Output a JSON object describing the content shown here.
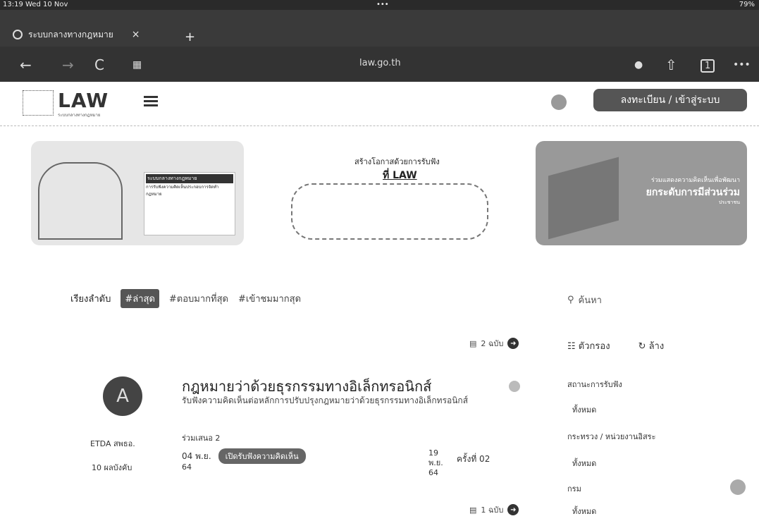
{
  "status": {
    "time": "13:19 Wed 10 Nov",
    "dots": "•••",
    "battery": "79%"
  },
  "browser": {
    "tab_title": "ระบบกลางทางกฎหมาย",
    "tab_close": "×",
    "new_tab": "+",
    "url": "law.go.th",
    "back": "←",
    "forward": "→",
    "reload": "C",
    "share": "⇧",
    "tabs_count": "1",
    "more": "•••"
  },
  "site": {
    "logo_word": "LAW",
    "logo_sub": "ระบบกลางทางกฎหมาย",
    "register_label": "ลงทะเบียน / เข้าสู่ระบบ"
  },
  "banners": [
    {
      "card_title": "ระบบกลางทางกฎหมาย",
      "card_text": "การรับฟังความคิดเห็นประกอบการจัดทำกฎหมาย"
    },
    {
      "line1": "สร้างโอกาสด้วยการรับฟัง",
      "line2": "ที่ LAW"
    },
    {
      "line1": "ร่วมแสดงความคิดเห็นเพื่อพัฒนา",
      "line2": "ยกระดับการมีส่วนร่วม",
      "line3": "ประชาชน"
    }
  ],
  "sort": {
    "label": "เรียงลำดับ",
    "options": [
      "#ล่าสุด",
      "#ตอบมากที่สุด",
      "#เข้าชมมากสุด"
    ]
  },
  "search": {
    "placeholder": "ค้นหา"
  },
  "filters": {
    "title": "ตัวกรอง",
    "clear": "ล้าง",
    "status_label": "สถานะการรับฟัง",
    "status_value": "ทั้งหมด",
    "ministry_label": "กระทรวง / หน่วยงานอิสระ",
    "ministry_value": "ทั้งหมด",
    "dept_label": "กรม",
    "dept_value": "ทั้งหมด"
  },
  "list": {
    "top_count": "2 ฉบับ",
    "item": {
      "logo_text": "A",
      "org": "ETDA สพธอ.",
      "agency": "10 ผลบังคับ",
      "title": "กฎหมายว่าด้วยธุรกรรมทางอิเล็กทรอนิกส์",
      "desc": "รับฟังความคิดเห็นต่อหลักการปรับปรุงกฎหมายว่าด้วยธุรกรรมทางอิเล็กทรอนิกส์",
      "meta": "ร่วมเสนอ  2",
      "start_date": "04 พ.ย.",
      "status_pill": "เปิดรับฟังความคิดเห็น",
      "year": "64",
      "end_date": "19 พ.ย. 64",
      "round": "ครั้งที่  02"
    },
    "bottom_count": "1 ฉบับ"
  }
}
